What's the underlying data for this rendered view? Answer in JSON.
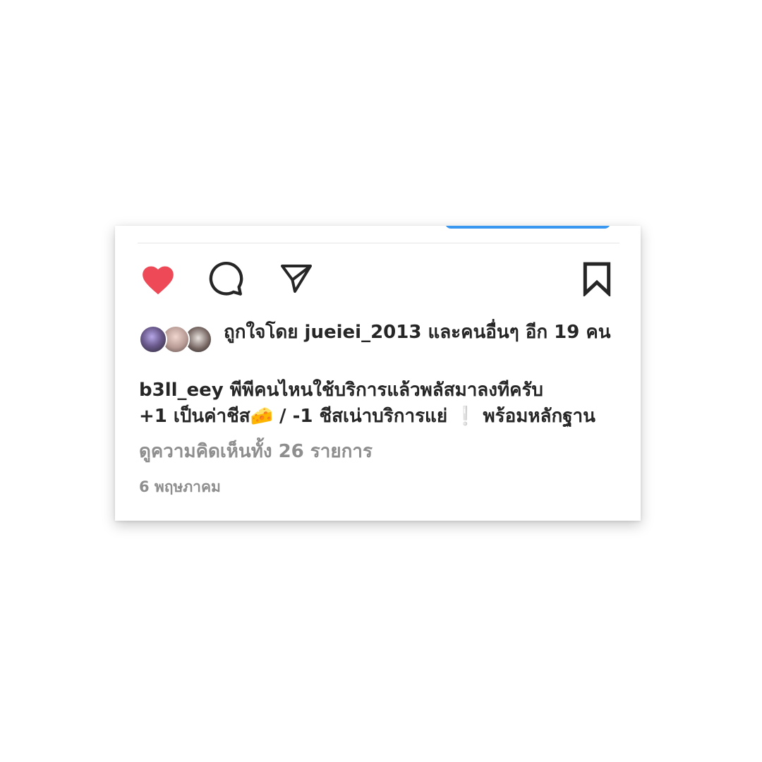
{
  "post": {
    "actions": {
      "like_icon": "heart-filled-icon",
      "comment_icon": "comment-icon",
      "share_icon": "paper-plane-icon",
      "save_icon": "bookmark-icon",
      "like_color": "#ed4956"
    },
    "likes": {
      "text": "ถูกใจโดย jueiei_2013 และคนอื่นๆ อีก 19 คน"
    },
    "caption": {
      "line1": "b3ll_eey พีพีคนไหนใช้บริการแล้วพลัสมาลงทีครับ",
      "line2": "+1 เป็นค่าชีส🧀 / -1 ชีสเน่าบริการแย่ ❕ พร้อมหลักฐาน"
    },
    "view_comments": "ดูความคิดเห็นทั้ง 26 รายการ",
    "date": "6 พฤษภาคม"
  }
}
